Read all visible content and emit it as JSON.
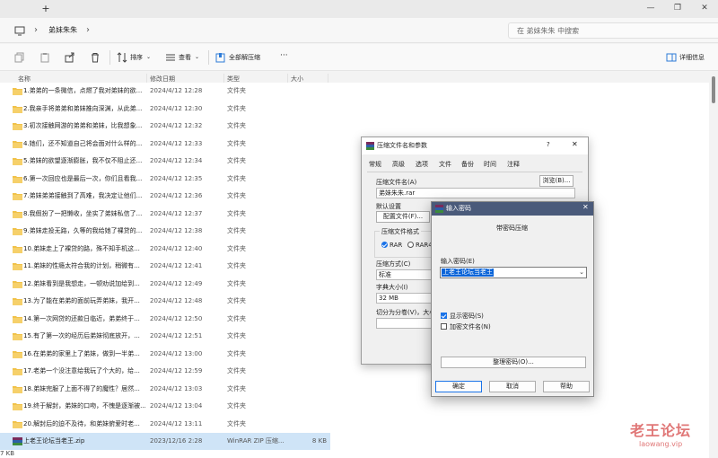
{
  "window": {
    "new_tab_label": "+",
    "controls": [
      "—",
      "❐",
      "✕"
    ]
  },
  "address": {
    "breadcrumb": "弟妹朱朱",
    "search_placeholder": "在 弟妹朱朱 中搜索"
  },
  "toolbar": {
    "sort_label": "排序",
    "view_label": "查看",
    "extract_all_label": "全部解压缩",
    "more_label": "···",
    "details_label": "详细信息"
  },
  "columns": {
    "name": "名称",
    "date": "修改日期",
    "type": "类型",
    "size": "大小"
  },
  "files": [
    {
      "name": "1.弟弟的一条微信，点燃了我对弟妹的欲...",
      "date": "2024/4/12 12:28",
      "type": "文件夹",
      "size": ""
    },
    {
      "name": "2.我亲手将弟弟和弟妹推向深渊，从此弟...",
      "date": "2024/4/12 12:30",
      "type": "文件夹",
      "size": ""
    },
    {
      "name": "3.初次接触网游的弟弟和弟妹，比我想象...",
      "date": "2024/4/12 12:32",
      "type": "文件夹",
      "size": ""
    },
    {
      "name": "4.她们，还不知道自己将会面对什么样的...",
      "date": "2024/4/12 12:33",
      "type": "文件夹",
      "size": ""
    },
    {
      "name": "5.弟妹的欲望逐渐膨胀，我不仅不阻止还...",
      "date": "2024/4/12 12:34",
      "type": "文件夹",
      "size": ""
    },
    {
      "name": "6.第一次回应也是最后一次，你们且看我...",
      "date": "2024/4/12 12:35",
      "type": "文件夹",
      "size": ""
    },
    {
      "name": "7.弟妹弟弟接触到了高难，我决定让他们...",
      "date": "2024/4/12 12:36",
      "type": "文件夹",
      "size": ""
    },
    {
      "name": "8.我假扮了一把懒收，坐实了弟妹私信了...",
      "date": "2024/4/12 12:37",
      "type": "文件夹",
      "size": ""
    },
    {
      "name": "9.弟妹走投无路，久等的我给她了裸贷的...",
      "date": "2024/4/12 12:38",
      "type": "文件夹",
      "size": ""
    },
    {
      "name": "10.弟妹走上了裸贷的路，殊不知手机这...",
      "date": "2024/4/12 12:40",
      "type": "文件夹",
      "size": ""
    },
    {
      "name": "11.弟妹的性瘾太符合我的计划，稍微有...",
      "date": "2024/4/12 12:41",
      "type": "文件夹",
      "size": ""
    },
    {
      "name": "12.弟妹看到是我想走，一顿劝说加给到...",
      "date": "2024/4/12 12:49",
      "type": "文件夹",
      "size": ""
    },
    {
      "name": "13.为了能在弟弟的面前玩弄弟妹，我开...",
      "date": "2024/4/12 12:48",
      "type": "文件夹",
      "size": ""
    },
    {
      "name": "14.第一次网贷的还款日临近，弟弟终于...",
      "date": "2024/4/12 12:50",
      "type": "文件夹",
      "size": ""
    },
    {
      "name": "15.有了第一次的经历后弟妹彻底放开，...",
      "date": "2024/4/12 12:51",
      "type": "文件夹",
      "size": ""
    },
    {
      "name": "16.在弟弟的家里上了弟妹，做到一半弟...",
      "date": "2024/4/12 13:00",
      "type": "文件夹",
      "size": ""
    },
    {
      "name": "17.老弟一个没注意给我玩了个大的，给...",
      "date": "2024/4/12 12:59",
      "type": "文件夹",
      "size": ""
    },
    {
      "name": "18.弟妹完服了上面不得了的魔性？居然...",
      "date": "2024/4/12 13:03",
      "type": "文件夹",
      "size": ""
    },
    {
      "name": "19.终于解封，弟妹的口吻，不愧是逐渐被...",
      "date": "2024/4/12 13:04",
      "type": "文件夹",
      "size": ""
    },
    {
      "name": "20.解封后的迫不及待，和弟妹俯爱时老...",
      "date": "2024/4/12 13:11",
      "type": "文件夹",
      "size": ""
    },
    {
      "name": "上老王论坛当老王.zip",
      "date": "2023/12/16 2:28",
      "type": "WinRAR ZIP 压缩...",
      "size": "8 KB"
    }
  ],
  "status_text": "7 KB",
  "archive_dialog": {
    "title": "压缩文件名和参数",
    "help_glyph": "?",
    "tabs": [
      "常规",
      "高级",
      "选项",
      "文件",
      "备份",
      "时间",
      "注释"
    ],
    "archive_name_label": "压缩文件名(A)",
    "archive_name_value": "弟妹朱朱.rar",
    "browse_label": "浏览(B)...",
    "profiles_label": "默认设置",
    "profiles_button": "配置文件(F)...",
    "format_label": "压缩文件格式",
    "format_rar": "RAR",
    "format_rar4": "RAR4",
    "method_label": "压缩方式(C)",
    "method_value": "标准",
    "dict_label": "字典大小(I)",
    "dict_value": "32 MB",
    "split_label": "切分为分卷(V)，大小"
  },
  "password_dialog": {
    "title": "输入密码",
    "subtitle": "带密码压缩",
    "enter_label": "输入密码(E)",
    "password_value": "上老王论坛当老王",
    "show_password_label": "显示密码(S)",
    "show_password_checked": true,
    "encrypt_names_label": "加密文件名(N)",
    "encrypt_names_checked": false,
    "organize_label": "整理密码(O)...",
    "ok_label": "确定",
    "cancel_label": "取消",
    "help_label": "帮助"
  },
  "watermark": {
    "line1": "老王论坛",
    "line2": "laowang.vip"
  },
  "colors": {
    "folder": "#f1c24a",
    "selection": "#cfe4f7",
    "accent": "#1a73e8",
    "dialog_title": "#4a5a7a",
    "watermark": "#d64a4a"
  }
}
